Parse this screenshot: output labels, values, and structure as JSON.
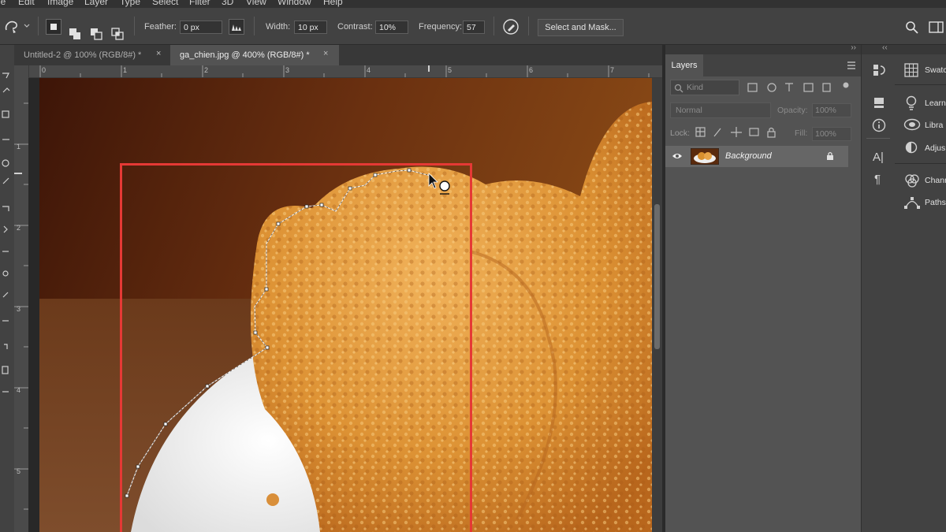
{
  "menu": {
    "items": [
      "le",
      "Edit",
      "Image",
      "Layer",
      "Type",
      "Select",
      "Filter",
      "3D",
      "View",
      "Window",
      "Help"
    ]
  },
  "options": {
    "feather_label": "Feather:",
    "feather_value": "0 px",
    "width_label": "Width:",
    "width_value": "10 px",
    "contrast_label": "Contrast:",
    "contrast_value": "10%",
    "frequency_label": "Frequency:",
    "frequency_value": "57",
    "select_mask_label": "Select and Mask..."
  },
  "tabs": {
    "tab1_label": "Untitled-2 @ 100% (RGB/8#) *",
    "tab2_label": "ga_chien.jpg @ 400% (RGB/8#) *",
    "close_glyph": "×"
  },
  "ruler": {
    "h_ticks": [
      "0",
      "1",
      "2",
      "3",
      "4",
      "5",
      "6",
      "7"
    ],
    "v_ticks": [
      "1",
      "2",
      "3",
      "4",
      "5"
    ]
  },
  "layers": {
    "title": "Layers",
    "kind_placeholder": "Kind",
    "blend_mode": "Normal",
    "opacity_label": "Opacity:",
    "opacity_value": "100%",
    "lock_label": "Lock:",
    "fill_label": "Fill:",
    "fill_value": "100%",
    "layer_name": "Background"
  },
  "right_panels": {
    "items": [
      "Swatc",
      "Learn",
      "Libra",
      "Adjus",
      "Chann",
      "Paths"
    ]
  },
  "icons": {
    "character_label": "A|",
    "paragraph_label": "¶"
  },
  "colors": {
    "selection_box": "#e53935",
    "ui_dark": "#323232",
    "ui_mid": "#424242",
    "panel": "#535353"
  }
}
